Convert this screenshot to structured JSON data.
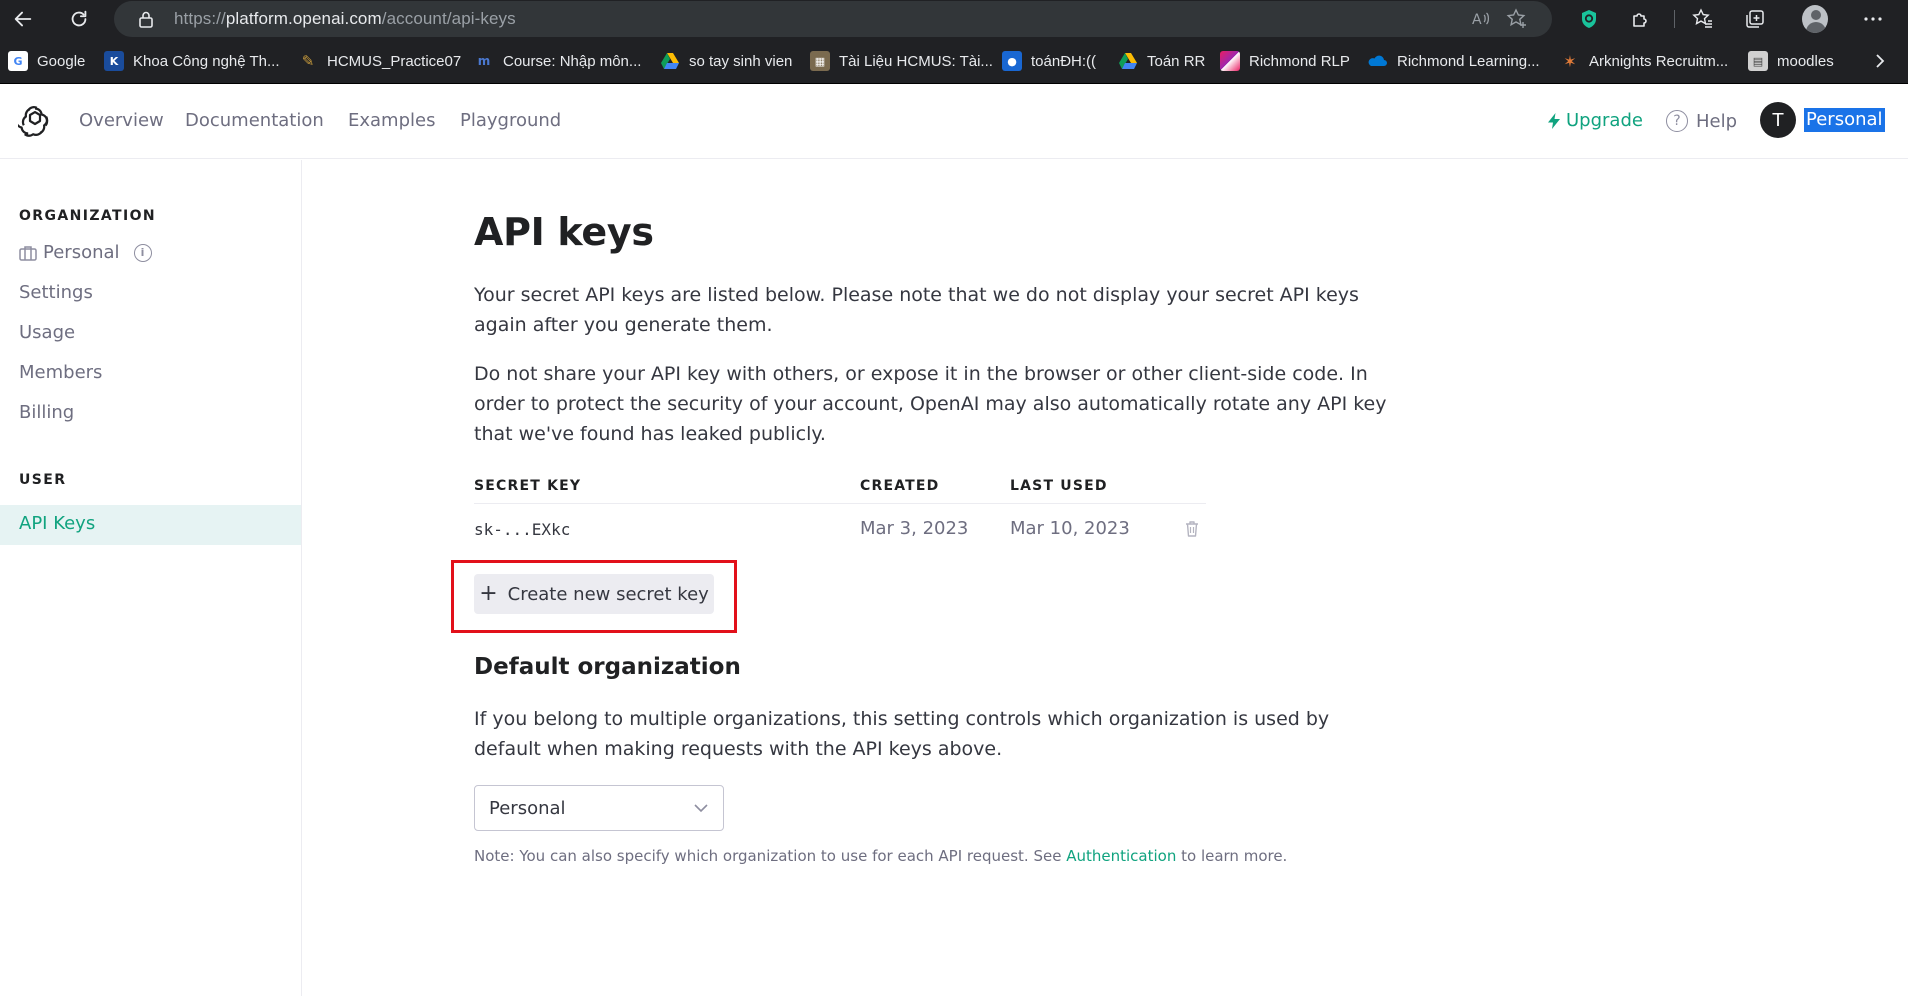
{
  "browser": {
    "url_scheme": "https://",
    "url_host": "platform.openai.com",
    "url_path": "/account/api-keys",
    "bookmarks": [
      {
        "label": "Google",
        "icon": "google-icon",
        "color": "#4285f4"
      },
      {
        "label": "Khoa Công nghệ Th...",
        "icon": "khoa-cntt-icon",
        "color": "#1a4c9c"
      },
      {
        "label": "HCMUS_Practice07",
        "icon": "pencil-icon",
        "color": "#c89b3c"
      },
      {
        "label": "Course: Nhập môn...",
        "icon": "moodle-icon",
        "color": "#1f4e9c"
      },
      {
        "label": "so tay sinh vien",
        "icon": "drive-icon",
        "color": "#0f9d58"
      },
      {
        "label": "Tài Liệu HCMUS: Tài...",
        "icon": "building-icon",
        "color": "#7a6a4f"
      },
      {
        "label": "toánĐH:((",
        "icon": "classroom-icon",
        "color": "#1967d2"
      },
      {
        "label": "Toán RR",
        "icon": "drive-icon",
        "color": "#0f9d58"
      },
      {
        "label": "Richmond RLP",
        "icon": "richmond-icon",
        "color": "#9c27b0"
      },
      {
        "label": "Richmond Learning...",
        "icon": "onedrive-icon",
        "color": "#0078d4"
      },
      {
        "label": "Arknights Recruitm...",
        "icon": "arknights-icon",
        "color": "#e07b39"
      },
      {
        "label": "moodles",
        "icon": "moodle-icon",
        "color": "#6e6e6e"
      }
    ]
  },
  "header": {
    "nav": [
      "Overview",
      "Documentation",
      "Examples",
      "Playground"
    ],
    "upgrade": "Upgrade",
    "help": "Help",
    "avatar_initial": "T",
    "account": "Personal"
  },
  "sidebar": {
    "org_heading": "ORGANIZATION",
    "org_items": [
      "Personal",
      "Settings",
      "Usage",
      "Members",
      "Billing"
    ],
    "user_heading": "USER",
    "active_item": "API Keys"
  },
  "main": {
    "title": "API keys",
    "intro": "Your secret API keys are listed below. Please note that we do not display your secret API keys again after you generate them.",
    "warning": "Do not share your API key with others, or expose it in the browser or other client-side code. In order to protect the security of your account, OpenAI may also automatically rotate any API key that we've found has leaked publicly.",
    "table": {
      "headers": [
        "SECRET KEY",
        "CREATED",
        "LAST USED"
      ],
      "rows": [
        {
          "key": "sk-...EXkc",
          "created": "Mar 3, 2023",
          "last_used": "Mar 10, 2023"
        }
      ]
    },
    "create_button": "Create new secret key",
    "default_org_title": "Default organization",
    "default_org_text": "If you belong to multiple organizations, this setting controls which organization is used by default when making requests with the API keys above.",
    "select_value": "Personal",
    "note_prefix": "Note: You can also specify which organization to use for each API request. See ",
    "note_link": "Authentication",
    "note_suffix": " to learn more."
  },
  "colors": {
    "accent": "#10a37f",
    "highlight_box": "#e2101a",
    "active_bg": "#e6f3f3"
  }
}
